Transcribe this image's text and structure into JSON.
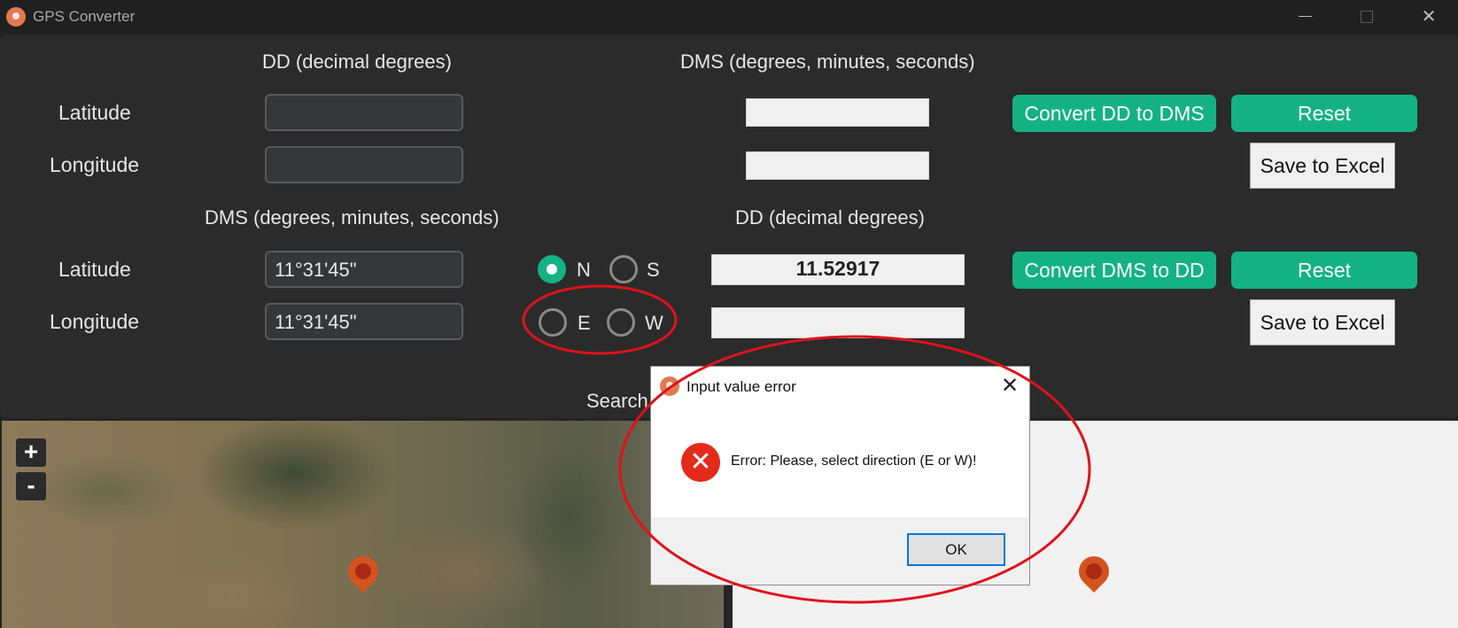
{
  "window": {
    "title": "GPS Converter",
    "icon": "map-pin-icon",
    "controls": {
      "minimize": "minimize-icon",
      "maximize": "maximize-icon",
      "close": "✕"
    }
  },
  "dd_to_dms": {
    "left_header": "DD (decimal degrees)",
    "right_header": "DMS (degrees, minutes, seconds)",
    "latitude_label": "Latitude",
    "longitude_label": "Longitude",
    "latitude_input": "",
    "longitude_input": "",
    "latitude_output": "",
    "longitude_output": "",
    "convert_button": "Convert DD to DMS",
    "reset_button": "Reset",
    "save_button": "Save to Excel"
  },
  "dms_to_dd": {
    "left_header": "DMS (degrees, minutes, seconds)",
    "right_header": "DD (decimal degrees)",
    "latitude_label": "Latitude",
    "longitude_label": "Longitude",
    "latitude_input": "11°31'45\"",
    "longitude_input": "11°31'45\"",
    "lat_dir_n": "N",
    "lat_dir_s": "S",
    "lon_dir_e": "E",
    "lon_dir_w": "W",
    "lat_selected": "N",
    "lon_selected": "",
    "latitude_output": "11.52917",
    "longitude_output": "",
    "convert_button": "Convert DMS to DD",
    "reset_button": "Reset",
    "save_button": "Save to Excel"
  },
  "search": {
    "label": "Search"
  },
  "map": {
    "zoom_in": "+",
    "zoom_out": "-",
    "marker_icon": "map-marker-icon"
  },
  "dialog": {
    "title": "Input value error",
    "close": "✕",
    "icon": "error-icon",
    "error_glyph": "✕",
    "message": "Error: Please, select direction (E or W)!",
    "ok_button": "OK"
  },
  "colors": {
    "accent_green": "#14b283",
    "annotation_red": "#e0121b",
    "error_red": "#e32a1b",
    "marker_orange": "#d4541f"
  }
}
